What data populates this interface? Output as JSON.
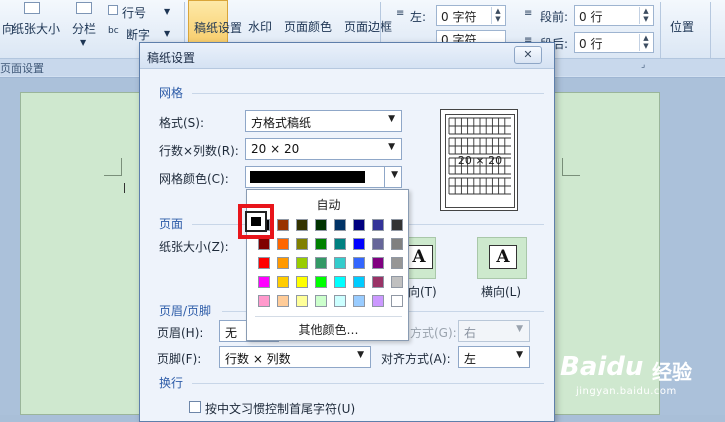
{
  "ribbon": {
    "direction_label": "向",
    "paper_size_label": "纸张大小",
    "columns_label": "分栏",
    "line_number_label": "行号",
    "line_number_arrow": "▼",
    "break_label": "断字",
    "break_arrow": "▼",
    "grid_paper_label": "稿纸设置",
    "watermark_label": "水印",
    "page_color_label": "页面颜色",
    "page_border_label": "页面边框",
    "indent_left_label": "左:",
    "indent_left_value": "0 字符",
    "indent_right_value": "0 字符",
    "spacing_before_label": "段前:",
    "spacing_before_value": "0 行",
    "spacing_after_label": "段后:",
    "spacing_after_value": "0 行",
    "position_label": "位置",
    "page_setup_group": "页面设置"
  },
  "dialog": {
    "title": "稿纸设置",
    "close_glyph": "✕",
    "grid_section": "网格",
    "format_label": "格式(S):",
    "format_value": "方格式稿纸",
    "rowcol_label": "行数×列数(R):",
    "rowcol_value": "20 × 20",
    "grid_color_label": "网格颜色(C):",
    "preview_text": "20 × 20",
    "page_section": "页面",
    "paper_size_label": "纸张大小(Z):",
    "portrait_label": "向(T)",
    "landscape_label": "横向(L)",
    "orient_letter": "A",
    "header_footer_section": "页眉/页脚",
    "header_label": "页眉(H):",
    "header_value": "无",
    "header_align_label": "方式(G):",
    "header_align_value": "右",
    "footer_label": "页脚(F):",
    "footer_value": "行数 × 列数",
    "footer_align_label": "对齐方式(A):",
    "footer_align_value": "左",
    "wrap_section": "换行",
    "wrap_checkbox_label": "按中文习惯控制首尾字符(U)",
    "arrow_glyph": "▼"
  },
  "color_popup": {
    "auto_label": "自动",
    "more_colors_label": "其他颜色…",
    "rows": [
      [
        "#000000",
        "#993300",
        "#333300",
        "#003300",
        "#003366",
        "#000080",
        "#333399",
        "#333333"
      ],
      [
        "#800000",
        "#FF6600",
        "#808000",
        "#008000",
        "#008080",
        "#0000FF",
        "#666699",
        "#808080"
      ],
      [
        "#FF0000",
        "#FF9900",
        "#99CC00",
        "#339966",
        "#33CCCC",
        "#3366FF",
        "#800080",
        "#969696"
      ],
      [
        "#FF00FF",
        "#FFCC00",
        "#FFFF00",
        "#00FF00",
        "#00FFFF",
        "#00CCFF",
        "#993366",
        "#C0C0C0"
      ],
      [
        "#FF99CC",
        "#FFCC99",
        "#FFFF99",
        "#CCFFCC",
        "#CCFFFF",
        "#99CCFF",
        "#CC99FF",
        "#FFFFFF"
      ]
    ],
    "selected_color": "#000000",
    "highlight_color": "#E8151B"
  },
  "watermark": {
    "brand_text": "Baidu",
    "brand_cn": "经验",
    "url": "jingyan.baidu.com"
  }
}
